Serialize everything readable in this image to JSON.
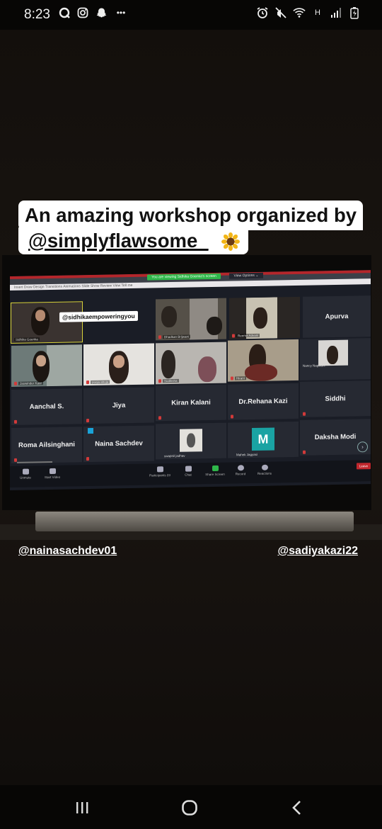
{
  "status_bar": {
    "time": "8:23",
    "left_icons": [
      "q-icon",
      "instagram-icon",
      "snapchat-icon",
      "more-icon"
    ],
    "more": "•••",
    "network": "H"
  },
  "caption": {
    "line1": "An amazing workshop organized by",
    "line2_handle": "@simplyflawsome_",
    "emoji": "sunflower-icon"
  },
  "zoom": {
    "share_notice": "You are viewing Sidhika Goenka's screen",
    "view_options": "View Options ⌄",
    "menu": "Insert   Draw   Design   Transitions   Animations   Slide Show   Review   View   Tell me",
    "participants": [
      {
        "name": "Sidhika Goenka",
        "handle_overlay": "@sidhikaempoweringyou",
        "video": true,
        "active_speaker": true
      },
      {
        "name": "Dhadkan Brijwani",
        "video": true
      },
      {
        "name": "Reema Advani",
        "video": true
      },
      {
        "name": "Apurva",
        "video": false
      },
      {
        "name": "Jaswinder Kaur",
        "video": true
      },
      {
        "name": "pooja ahuja",
        "video": true
      },
      {
        "name": "Sudiksha",
        "video": true
      },
      {
        "name": "Hirani",
        "video": true
      },
      {
        "name": "Nancy Nagwani",
        "video": true
      },
      {
        "name": "Aanchal S.",
        "video": false
      },
      {
        "name": "Jiya",
        "video": false
      },
      {
        "name": "Kiran Kalani",
        "video": false
      },
      {
        "name": "Dr.Rehana Kazi",
        "video": false
      },
      {
        "name": "Siddhi",
        "video": false
      },
      {
        "name": "Roma Ailsinghani",
        "video": false
      },
      {
        "name": "Naina Sachdev",
        "video": false
      },
      {
        "name": "swapnil jadhav",
        "video": true
      },
      {
        "name": "Mahek Jagyasi",
        "initial": "M",
        "video": false
      },
      {
        "name": "Daksha Modi",
        "video": false
      }
    ],
    "toolbar": {
      "unmute": "Unmute",
      "start_video": "Start Video",
      "participants": "Participants",
      "participants_count": "23",
      "chat": "Chat",
      "share_screen": "Share Screen",
      "record": "Record",
      "reactions": "Reactions",
      "leave": "Leave"
    }
  },
  "mentions": {
    "left": "@nainasachdev01",
    "right": "@sadiyakazi22"
  },
  "colors": {
    "caption_bg": "#ffffff",
    "zoom_accent": "#2fb74a",
    "leave_red": "#c0272d",
    "initial_tile": "#1aa3a3"
  }
}
